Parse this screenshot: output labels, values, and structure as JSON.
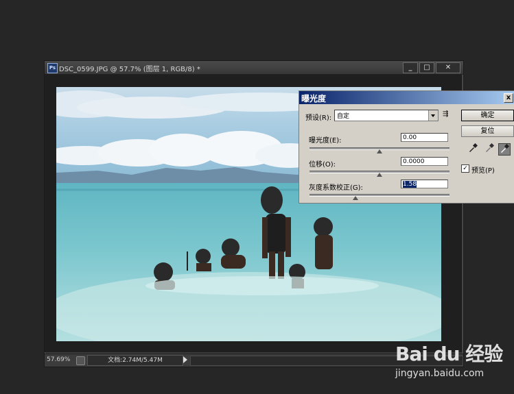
{
  "document": {
    "app_icon": "Ps",
    "title": "DSC_0599.JPG @ 57.7% (图层 1, RGB/8) *",
    "window_buttons": [
      "minimize-icon",
      "restore-icon",
      "close-icon"
    ],
    "status": {
      "zoom": "57.69%",
      "doc_info": "文档:2.74M/5.47M"
    }
  },
  "dialog": {
    "title": "曝光度",
    "close": "x",
    "preset_label": "预设(R):",
    "preset_value": "自定",
    "preset_menu_icon": "⇶",
    "exposure_label": "曝光度(E):",
    "exposure_value": "0.00",
    "exposure_level": 0.5,
    "offset_label": "位移(O):",
    "offset_value": "0.0000",
    "offset_level": 0.5,
    "gamma_label": "灰度系数校正(G):",
    "gamma_value": "1.58",
    "gamma_level": 0.33,
    "ok_label": "确定",
    "reset_label": "复位",
    "preview_checked": "✓",
    "preview_label": "预览(P)",
    "eyedroppers": [
      "black-eyedropper-icon",
      "gray-eyedropper-icon",
      "white-eyedropper-icon"
    ]
  },
  "watermark": {
    "brand": "Bai du 经验",
    "url": "jingyan.baidu.com"
  }
}
